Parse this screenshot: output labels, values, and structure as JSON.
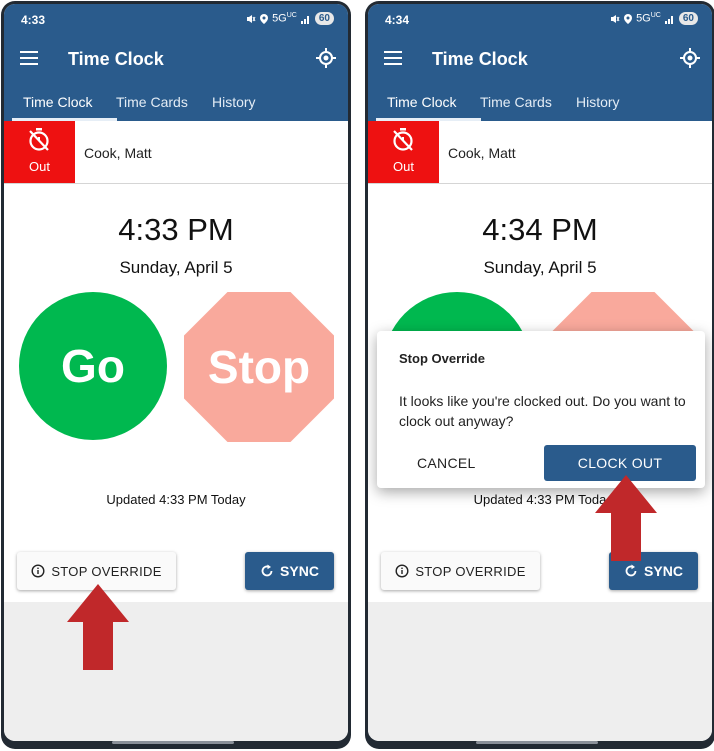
{
  "colors": {
    "appbar": "#2a5b8c",
    "out_badge": "#ee1111",
    "go": "#00b84f",
    "stop": "#f9a99c",
    "arrow": "#c0282a"
  },
  "left": {
    "status": {
      "time": "4:33",
      "network": "5G",
      "network_sup": "UC",
      "battery": "60"
    },
    "app_title": "Time Clock",
    "tabs": [
      {
        "label": "Time Clock"
      },
      {
        "label": "Time Cards"
      },
      {
        "label": "History"
      }
    ],
    "employee": {
      "status": "Out",
      "name": "Cook, Matt"
    },
    "clock": {
      "time": "4:33 PM",
      "date": "Sunday, April 5"
    },
    "go_label": "Go",
    "stop_label": "Stop",
    "updated": "Updated 4:33 PM Today",
    "override_label": "STOP OVERRIDE",
    "sync_label": "SYNC"
  },
  "right": {
    "status": {
      "time": "4:34",
      "network": "5G",
      "network_sup": "UC",
      "battery": "60"
    },
    "app_title": "Time Clock",
    "tabs": [
      {
        "label": "Time Clock"
      },
      {
        "label": "Time Cards"
      },
      {
        "label": "History"
      }
    ],
    "employee": {
      "status": "Out",
      "name": "Cook, Matt"
    },
    "clock": {
      "time": "4:34 PM",
      "date": "Sunday, April 5"
    },
    "updated": "Updated 4:33 PM Toda",
    "override_label": "STOP OVERRIDE",
    "sync_label": "SYNC",
    "dialog": {
      "title": "Stop Override",
      "message": "It looks like you're clocked out. Do you want to clock out anyway?",
      "cancel_label": "CANCEL",
      "confirm_label": "CLOCK OUT"
    }
  },
  "icons": {
    "menu": "hamburger-icon",
    "locate": "crosshair-icon",
    "out": "stopwatch-off-icon",
    "info": "info-icon",
    "sync": "refresh-icon",
    "arrow": "up-arrow-icon"
  }
}
